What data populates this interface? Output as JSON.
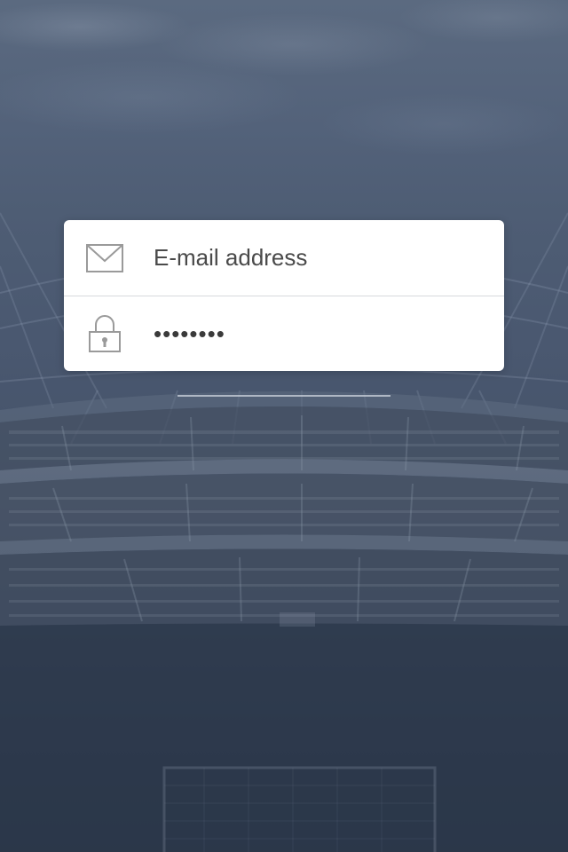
{
  "login": {
    "email": {
      "placeholder": "E-mail address",
      "value": "",
      "icon": "envelope-icon"
    },
    "password": {
      "masked_value": "••••••••",
      "icon": "lock-icon"
    }
  },
  "colors": {
    "background_top": "#5b6a80",
    "background_bottom": "#2d3a4f",
    "card": "#ffffff",
    "icon": "#9a9a9a",
    "text": "#3d3d3d"
  }
}
